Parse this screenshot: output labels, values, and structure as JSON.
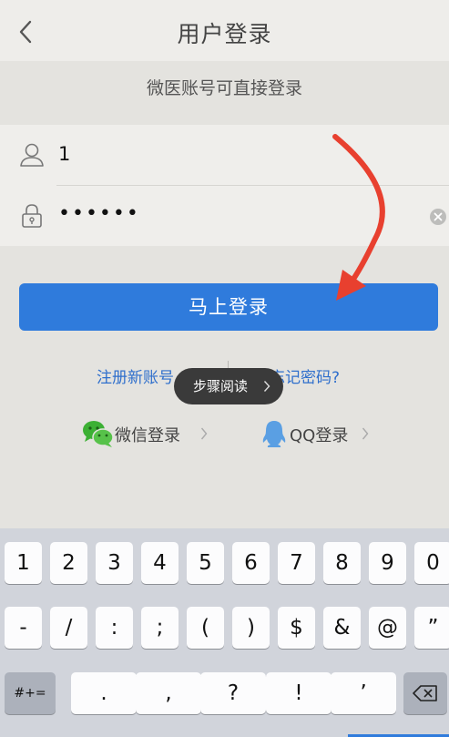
{
  "navbar": {
    "title": "用户登录",
    "back_icon": "chevron-left-icon"
  },
  "subtitle": "微医账号可直接登录",
  "form": {
    "username": {
      "icon": "user-icon",
      "value": "1"
    },
    "password": {
      "icon": "lock-icon",
      "value": "••••••",
      "clear_icon": "clear-icon"
    }
  },
  "login_button": {
    "label": "马上登录"
  },
  "links": {
    "register": "注册新账号",
    "forgot": "忘记密码?"
  },
  "toast": {
    "label": "步骤阅读",
    "icon": "chevron-right-icon"
  },
  "social": {
    "wechat": {
      "label": "微信登录",
      "icon": "wechat-icon"
    },
    "qq": {
      "label": "QQ登录",
      "icon": "qq-icon"
    }
  },
  "annotation": {
    "icon": "red-curved-arrow-icon",
    "color": "#e8402f"
  },
  "colors": {
    "accent": "#2f7bdc",
    "link": "#2f6fcc"
  },
  "keyboard": {
    "row1": [
      "1",
      "2",
      "3",
      "4",
      "5",
      "6",
      "7",
      "8",
      "9",
      "0"
    ],
    "row2": [
      "-",
      "/",
      ":",
      ";",
      "(",
      ")",
      "$",
      "&",
      "@",
      "”"
    ],
    "row3": [
      ".",
      ",",
      "?",
      "!",
      "’"
    ],
    "mode_key": "#+=",
    "backspace_icon": "backspace-icon"
  }
}
